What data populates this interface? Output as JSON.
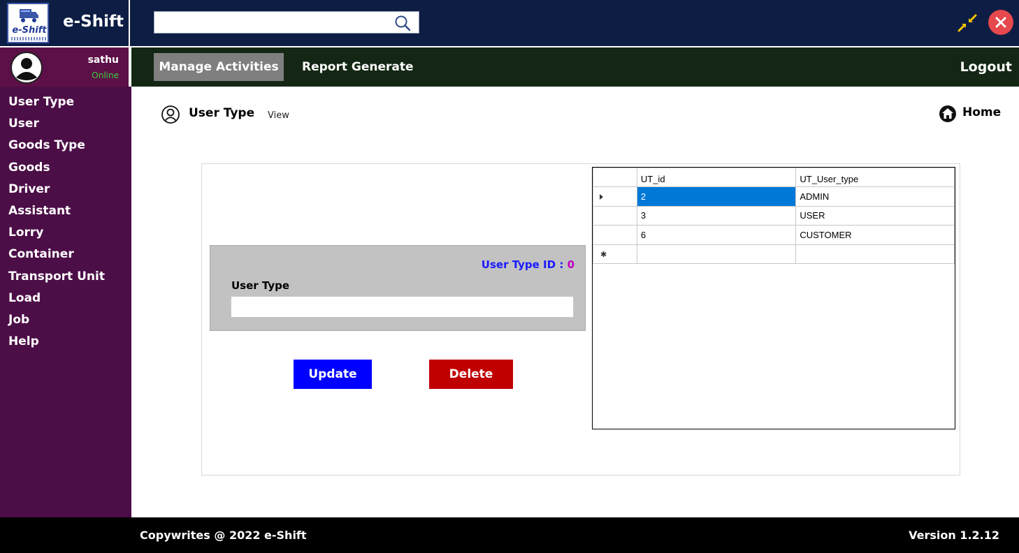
{
  "app": {
    "name": "e-Shift",
    "logo_text": "e-Shift"
  },
  "search": {
    "value": "",
    "placeholder": ""
  },
  "user": {
    "name": "sathu",
    "status": "Online"
  },
  "menu": {
    "items": [
      {
        "label": "Manage Activities",
        "active": true
      },
      {
        "label": "Report Generate",
        "active": false
      }
    ],
    "logout_label": "Logout"
  },
  "sidebar": {
    "items": [
      {
        "label": "User Type"
      },
      {
        "label": "User"
      },
      {
        "label": "Goods Type"
      },
      {
        "label": "Goods"
      },
      {
        "label": "Driver"
      },
      {
        "label": "Assistant"
      },
      {
        "label": "Lorry"
      },
      {
        "label": "Container"
      },
      {
        "label": "Transport Unit"
      },
      {
        "label": "Load"
      },
      {
        "label": "Job"
      },
      {
        "label": "Help"
      }
    ]
  },
  "page": {
    "title": "User Type",
    "subtitle": "View",
    "home_label": "Home"
  },
  "form": {
    "id_label": "User Type ID :",
    "id_value": "0",
    "field_label": "User Type",
    "field_value": "",
    "update_label": "Update",
    "delete_label": "Delete"
  },
  "grid": {
    "columns": [
      "UT_id",
      "UT_User_type"
    ],
    "rows": [
      {
        "id": "2",
        "type": "ADMIN",
        "selected": true
      },
      {
        "id": "3",
        "type": "USER",
        "selected": false
      },
      {
        "id": "6",
        "type": "CUSTOMER",
        "selected": false
      }
    ]
  },
  "footer": {
    "copyright": "Copywrites @ 2022 e-Shift",
    "version": "Version 1.2.12"
  },
  "colors": {
    "topbar": "#0d1d44",
    "menubar": "#142714",
    "sidebar": "#4c0e47",
    "userbox": "#5c1047",
    "update_button": "#0000ff",
    "delete_button": "#c00000",
    "selection": "#0078d7",
    "status_online": "#3bd13b",
    "id_label": "#1a1aff",
    "id_value": "#c000c0",
    "close_button": "#e5484d"
  },
  "icons": {
    "search": "search-icon",
    "shrink": "shrink-arrows-icon",
    "close": "close-icon",
    "avatar": "user-avatar-icon",
    "page": "user-circle-icon",
    "home": "home-icon"
  }
}
